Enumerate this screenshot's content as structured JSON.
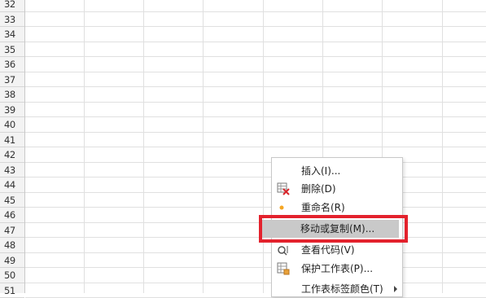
{
  "rows": [
    "32",
    "33",
    "34",
    "35",
    "36",
    "37",
    "38",
    "39",
    "40",
    "41",
    "42",
    "43",
    "44",
    "45",
    "46",
    "47",
    "48",
    "49",
    "50",
    "51"
  ],
  "context_menu": {
    "items": [
      {
        "label": "插入(I)...",
        "icon": "none"
      },
      {
        "label": "删除(D)",
        "icon": "delete-sheet-icon"
      },
      {
        "label": "重命名(R)",
        "icon": "rename-dot-icon"
      },
      {
        "label": "移动或复制(M)...",
        "icon": "none",
        "selected": true
      },
      {
        "label": "查看代码(V)",
        "icon": "view-code-icon"
      },
      {
        "label": "保护工作表(P)...",
        "icon": "protect-sheet-icon"
      },
      {
        "label": "工作表标签颜色(T)",
        "icon": "none",
        "submenu": true
      }
    ]
  },
  "colors": {
    "highlight_border": "#e3222d",
    "selected_bg": "#c9c9c9",
    "delete_icon_accent": "#d9262b",
    "rename_dot": "#f5a623"
  }
}
